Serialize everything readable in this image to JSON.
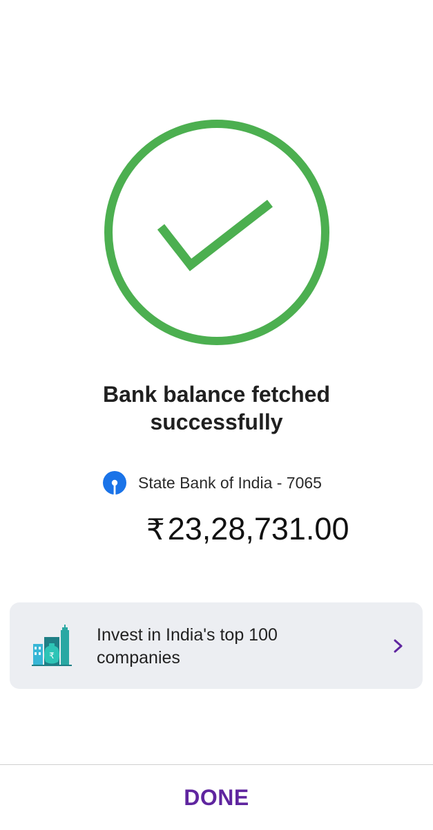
{
  "status": {
    "title_line1": "Bank balance fetched",
    "title_line2": "successfully",
    "icon": "check-circle-icon",
    "color": "#4caf50"
  },
  "account": {
    "bank_logo": "sbi-logo-icon",
    "bank_name": "State Bank of India - 7065",
    "currency_symbol": "₹",
    "balance": "23,28,731.00"
  },
  "promo": {
    "icon": "invest-buildings-icon",
    "text_line1": "Invest in India's top 100",
    "text_line2": "companies",
    "chevron": "chevron-right-icon"
  },
  "footer": {
    "done_label": "DONE",
    "accent_color": "#5f259f"
  }
}
